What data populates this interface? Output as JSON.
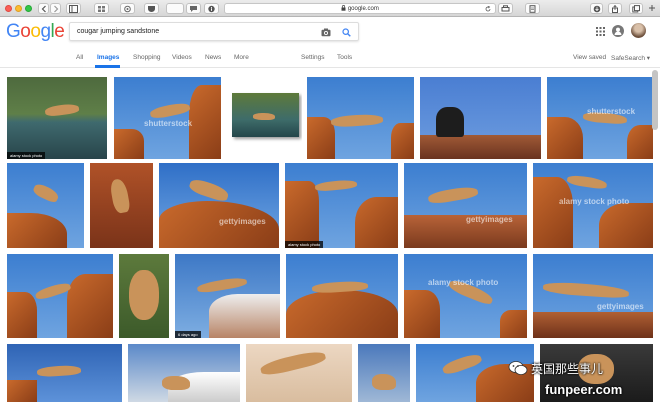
{
  "browser": {
    "url": "google.com",
    "badge": "1095"
  },
  "google": {
    "logo_letters": [
      {
        "ch": "G",
        "color": "#4285f4"
      },
      {
        "ch": "o",
        "color": "#ea4335"
      },
      {
        "ch": "o",
        "color": "#fbbc05"
      },
      {
        "ch": "g",
        "color": "#4285f4"
      },
      {
        "ch": "l",
        "color": "#34a853"
      },
      {
        "ch": "e",
        "color": "#ea4335"
      }
    ],
    "query": "cougar jumping sandstone"
  },
  "nav": {
    "all": "All",
    "images": "Images",
    "shopping": "Shopping",
    "videos": "Videos",
    "news": "News",
    "more": "More",
    "settings": "Settings",
    "tools": "Tools",
    "view_saved": "View saved",
    "safesearch": "SafeSearch"
  },
  "results": {
    "captions": {
      "alamy": "alamy stock photo",
      "days_ago": "6 days ago",
      "shutterstock": "shutterstock",
      "getty": "gettyimages"
    }
  },
  "watermark": {
    "wechat": "英国那些事儿",
    "site": "funpeer.com"
  }
}
